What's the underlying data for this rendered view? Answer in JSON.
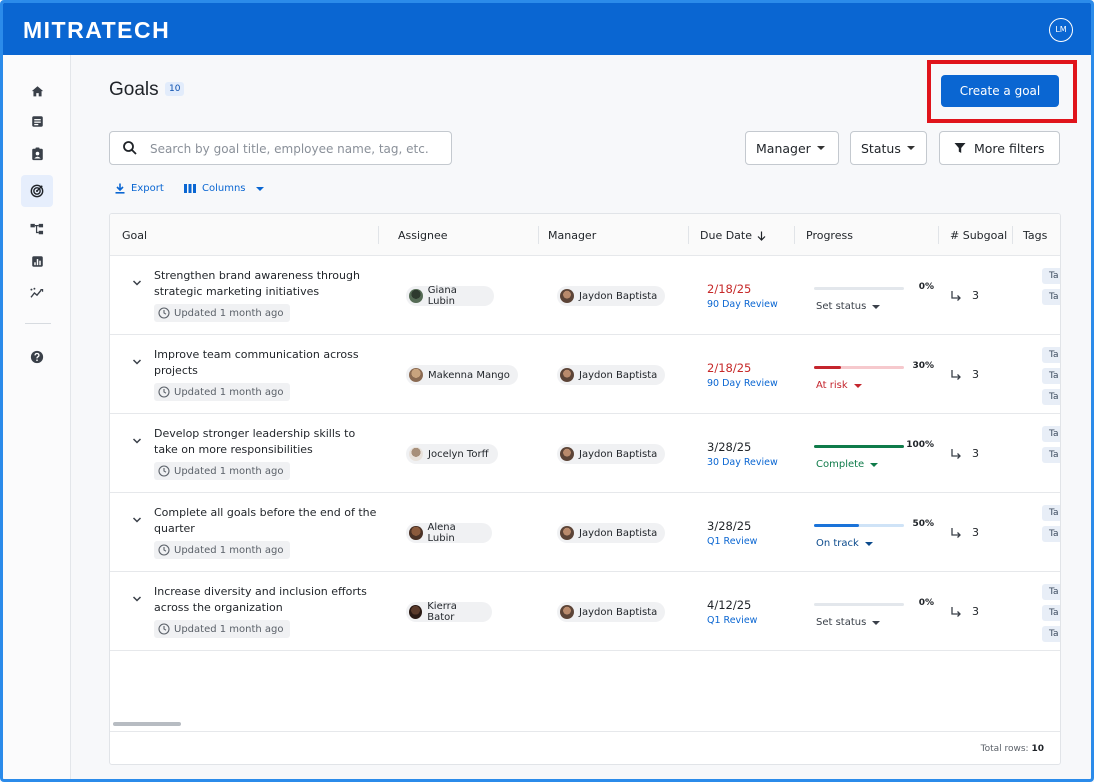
{
  "app": {
    "logo": "MITRATECH",
    "user_initials": "LM"
  },
  "sidebar": {
    "items": [
      {
        "icon": "home-icon"
      },
      {
        "icon": "notes-icon"
      },
      {
        "icon": "badge-icon"
      },
      {
        "icon": "target-icon",
        "active": true
      },
      {
        "icon": "org-chart-icon"
      },
      {
        "icon": "report-icon"
      },
      {
        "icon": "analytics-icon"
      },
      {
        "icon": "help-icon"
      }
    ]
  },
  "header": {
    "title": "Goals",
    "count": "10",
    "create_label": "Create a goal"
  },
  "search": {
    "placeholder": "Search by goal title, employee name, tag, etc."
  },
  "filters": {
    "manager": "Manager",
    "status": "Status",
    "more": "More filters"
  },
  "toolbar": {
    "export": "Export",
    "columns": "Columns"
  },
  "table": {
    "columns": [
      "Goal",
      "Assignee",
      "Manager",
      "Due Date",
      "Progress",
      "# Subgoal",
      "Tags"
    ],
    "rows": [
      {
        "title": "Strengthen brand awareness through strategic marketing initiatives",
        "updated": "Updated 1 month ago",
        "assignee": "Giana Lubin",
        "manager": "Jaydon Baptista",
        "due": "2/18/25",
        "due_overdue": true,
        "due_sub": "90 Day Review",
        "progress": 0,
        "progress_label": "0%",
        "status": "Set status",
        "status_kind": "none",
        "subgoals": "3",
        "tags": [
          "Ta",
          "Ta"
        ]
      },
      {
        "title": "Improve team communication across projects",
        "updated": "Updated 1 month ago",
        "assignee": "Makenna Mango",
        "manager": "Jaydon Baptista",
        "due": "2/18/25",
        "due_overdue": true,
        "due_sub": "90 Day Review",
        "progress": 30,
        "progress_label": "30%",
        "status": "At risk",
        "status_kind": "risk",
        "subgoals": "3",
        "tags": [
          "Ta",
          "Ta",
          "Ta"
        ]
      },
      {
        "title": "Develop stronger leadership skills to take on more responsibilities",
        "updated": "Updated 1 month ago",
        "assignee": "Jocelyn Torff",
        "manager": "Jaydon Baptista",
        "due": "3/28/25",
        "due_overdue": false,
        "due_sub": "30 Day Review",
        "progress": 100,
        "progress_label": "100%",
        "status": "Complete",
        "status_kind": "complete",
        "subgoals": "3",
        "tags": [
          "Ta",
          "Ta"
        ]
      },
      {
        "title": "Complete all goals before the end of the quarter",
        "updated": "Updated 1 month ago",
        "assignee": "Alena Lubin",
        "manager": "Jaydon Baptista",
        "due": "3/28/25",
        "due_overdue": false,
        "due_sub": "Q1 Review",
        "progress": 50,
        "progress_label": "50%",
        "status": "On track",
        "status_kind": "track",
        "subgoals": "3",
        "tags": [
          "Ta",
          "Ta"
        ]
      },
      {
        "title": "Increase diversity and inclusion efforts across the organization",
        "updated": "Updated 1 month ago",
        "assignee": "Kierra Bator",
        "manager": "Jaydon Baptista",
        "due": "4/12/25",
        "due_overdue": false,
        "due_sub": "Q1 Review",
        "progress": 0,
        "progress_label": "0%",
        "status": "Set status",
        "status_kind": "none",
        "subgoals": "3",
        "tags": [
          "Ta",
          "Ta",
          "Ta"
        ]
      }
    ],
    "total_label": "Total rows:",
    "total_value": "10"
  },
  "colors": {
    "brand": "#0a66d2",
    "overdue": "#c62828",
    "risk": "#c4252d",
    "risk_track": "#f6c9cd",
    "complete": "#0f7b4a",
    "track": "#1a73d9",
    "track_track": "#cfe3f7",
    "empty_track": "#e3e7ec",
    "highlight": "#e0141b"
  }
}
